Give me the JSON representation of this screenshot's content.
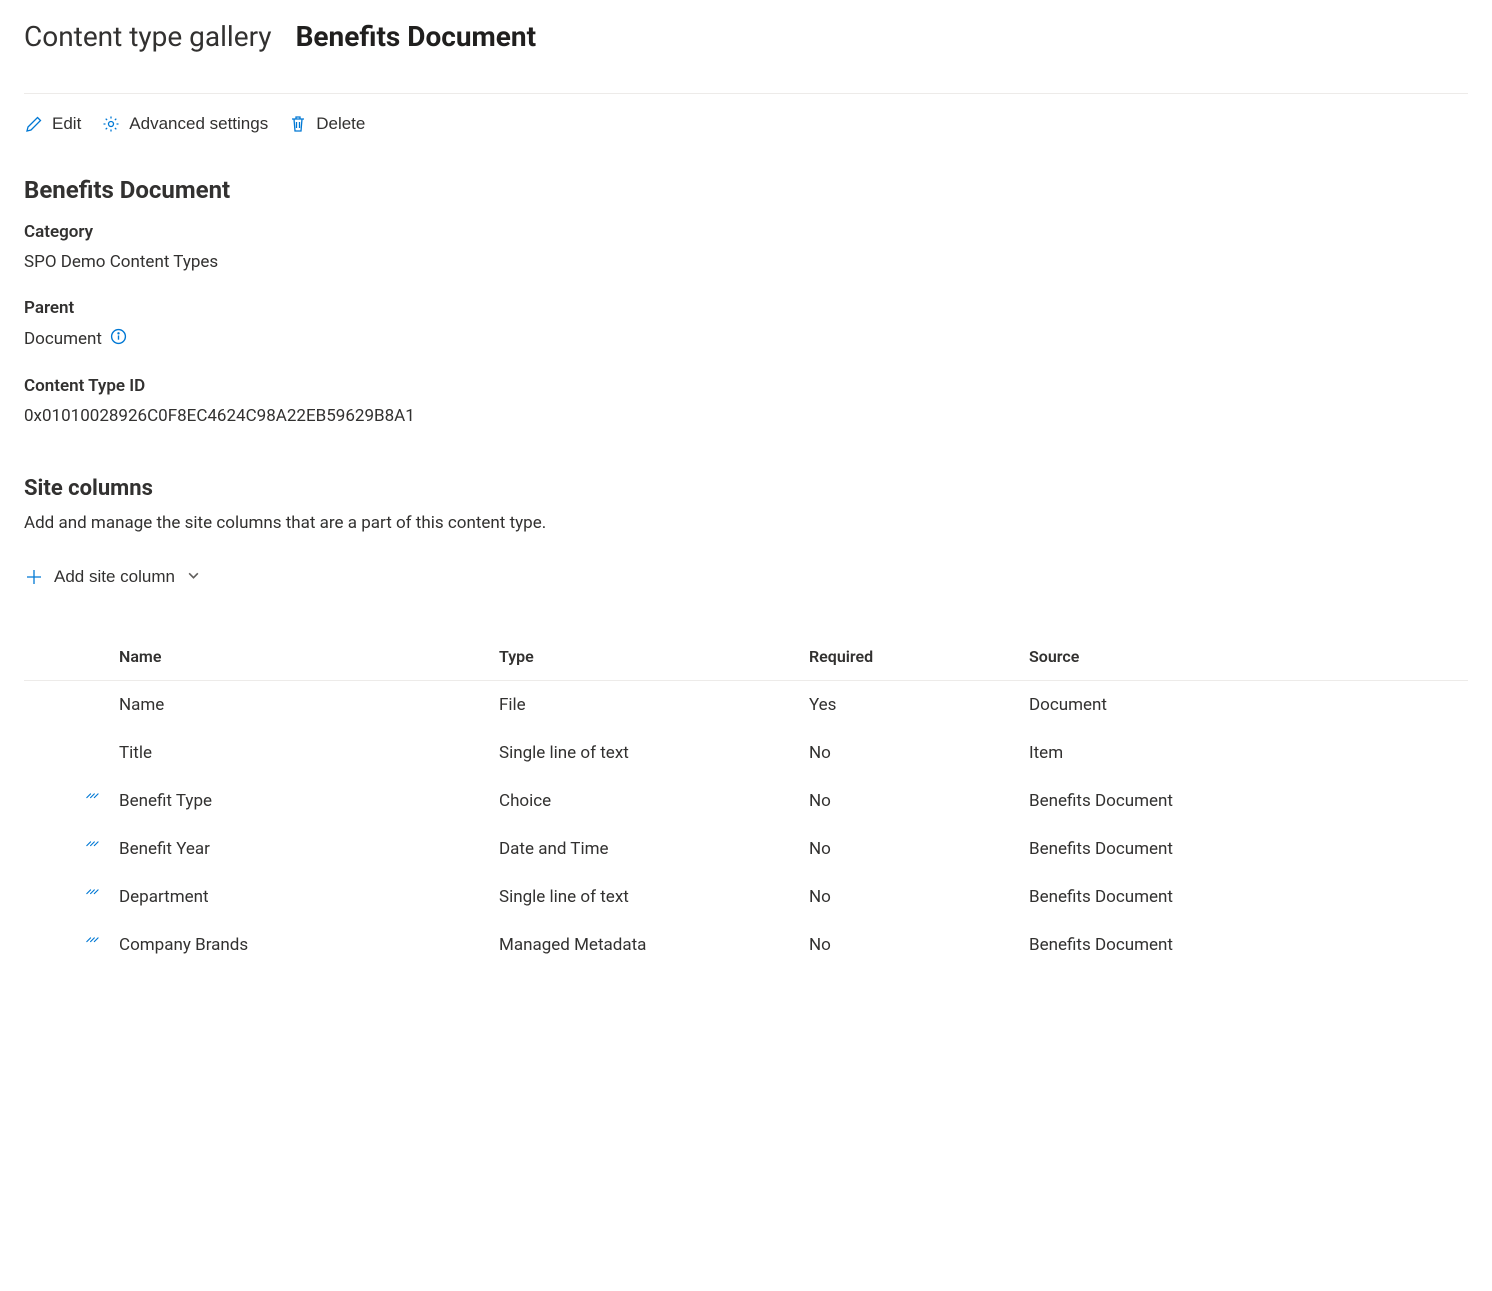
{
  "breadcrumb": {
    "parent": "Content type gallery",
    "current": "Benefits Document"
  },
  "toolbar": {
    "edit": "Edit",
    "advanced": "Advanced settings",
    "delete": "Delete"
  },
  "contentType": {
    "name": "Benefits Document",
    "categoryLabel": "Category",
    "categoryValue": "SPO Demo Content Types",
    "parentLabel": "Parent",
    "parentValue": "Document",
    "idLabel": "Content Type ID",
    "idValue": "0x01010028926C0F8EC4624C98A22EB59629B8A1"
  },
  "siteColumns": {
    "title": "Site columns",
    "description": "Add and manage the site columns that are a part of this content type.",
    "addLabel": "Add site column",
    "headers": {
      "name": "Name",
      "type": "Type",
      "required": "Required",
      "source": "Source"
    },
    "rows": [
      {
        "new": false,
        "name": "Name",
        "type": "File",
        "required": "Yes",
        "source": "Document"
      },
      {
        "new": false,
        "name": "Title",
        "type": "Single line of text",
        "required": "No",
        "source": "Item"
      },
      {
        "new": true,
        "name": "Benefit Type",
        "type": "Choice",
        "required": "No",
        "source": "Benefits Document"
      },
      {
        "new": true,
        "name": "Benefit Year",
        "type": "Date and Time",
        "required": "No",
        "source": "Benefits Document"
      },
      {
        "new": true,
        "name": "Department",
        "type": "Single line of text",
        "required": "No",
        "source": "Benefits Document"
      },
      {
        "new": true,
        "name": "Company Brands",
        "type": "Managed Metadata",
        "required": "No",
        "source": "Benefits Document"
      }
    ]
  }
}
